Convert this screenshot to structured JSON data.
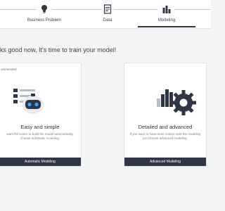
{
  "steps": [
    {
      "label": "Business Problem",
      "icon": "lightbulb-icon"
    },
    {
      "label": "Data",
      "icon": "document-icon"
    },
    {
      "label": "Modeling",
      "icon": "bar-chart-icon"
    }
  ],
  "active_step": "Modeling",
  "heading": "ks good now, It's  time to train your model!",
  "cards": {
    "easy": {
      "badge": "ommended",
      "title": "Easy and simple",
      "description": "want RE-Learn to build the model automatically, choose automatic modeling.",
      "button": "Automatic Modeling",
      "icon": "robot-icon"
    },
    "advanced": {
      "title": "Detailed and advanced",
      "description": "If you want to have more control over the modeling pro choose advanced modeling.",
      "button": "Advanced Modeling",
      "icon": "gear-icon"
    }
  },
  "colors": {
    "dark": "#2f3646",
    "accent_blue": "#2e7fd1",
    "background": "#f4f5f7"
  }
}
